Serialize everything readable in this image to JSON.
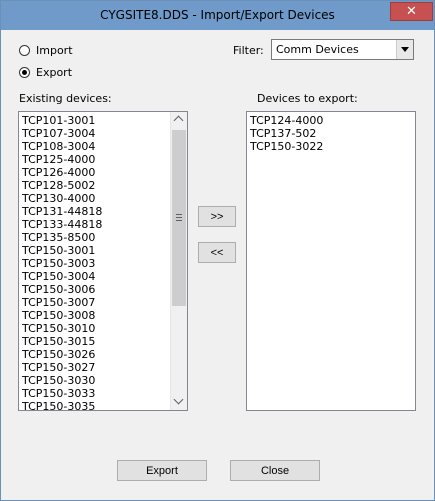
{
  "window": {
    "title": "CYGSITE8.DDS - Import/Export Devices",
    "close_symbol": "✕"
  },
  "mode": {
    "options": [
      {
        "label": "Import",
        "selected": false
      },
      {
        "label": "Export",
        "selected": true
      }
    ]
  },
  "filter": {
    "label": "Filter:",
    "value": "Comm Devices"
  },
  "existing": {
    "label": "Existing devices:",
    "items": [
      "TCP101-3001",
      "TCP107-3004",
      "TCP108-3004",
      "TCP125-4000",
      "TCP126-4000",
      "TCP128-5002",
      "TCP130-4000",
      "TCP131-44818",
      "TCP133-44818",
      "TCP135-8500",
      "TCP150-3001",
      "TCP150-3003",
      "TCP150-3004",
      "TCP150-3006",
      "TCP150-3007",
      "TCP150-3008",
      "TCP150-3010",
      "TCP150-3015",
      "TCP150-3026",
      "TCP150-3027",
      "TCP150-3030",
      "TCP150-3033",
      "TCP150-3035"
    ]
  },
  "export_list": {
    "label": "Devices to export:",
    "items": [
      "TCP124-4000",
      "TCP137-502",
      "TCP150-3022"
    ]
  },
  "buttons": {
    "add": ">>",
    "remove": "<<",
    "export": "Export",
    "close": "Close"
  }
}
